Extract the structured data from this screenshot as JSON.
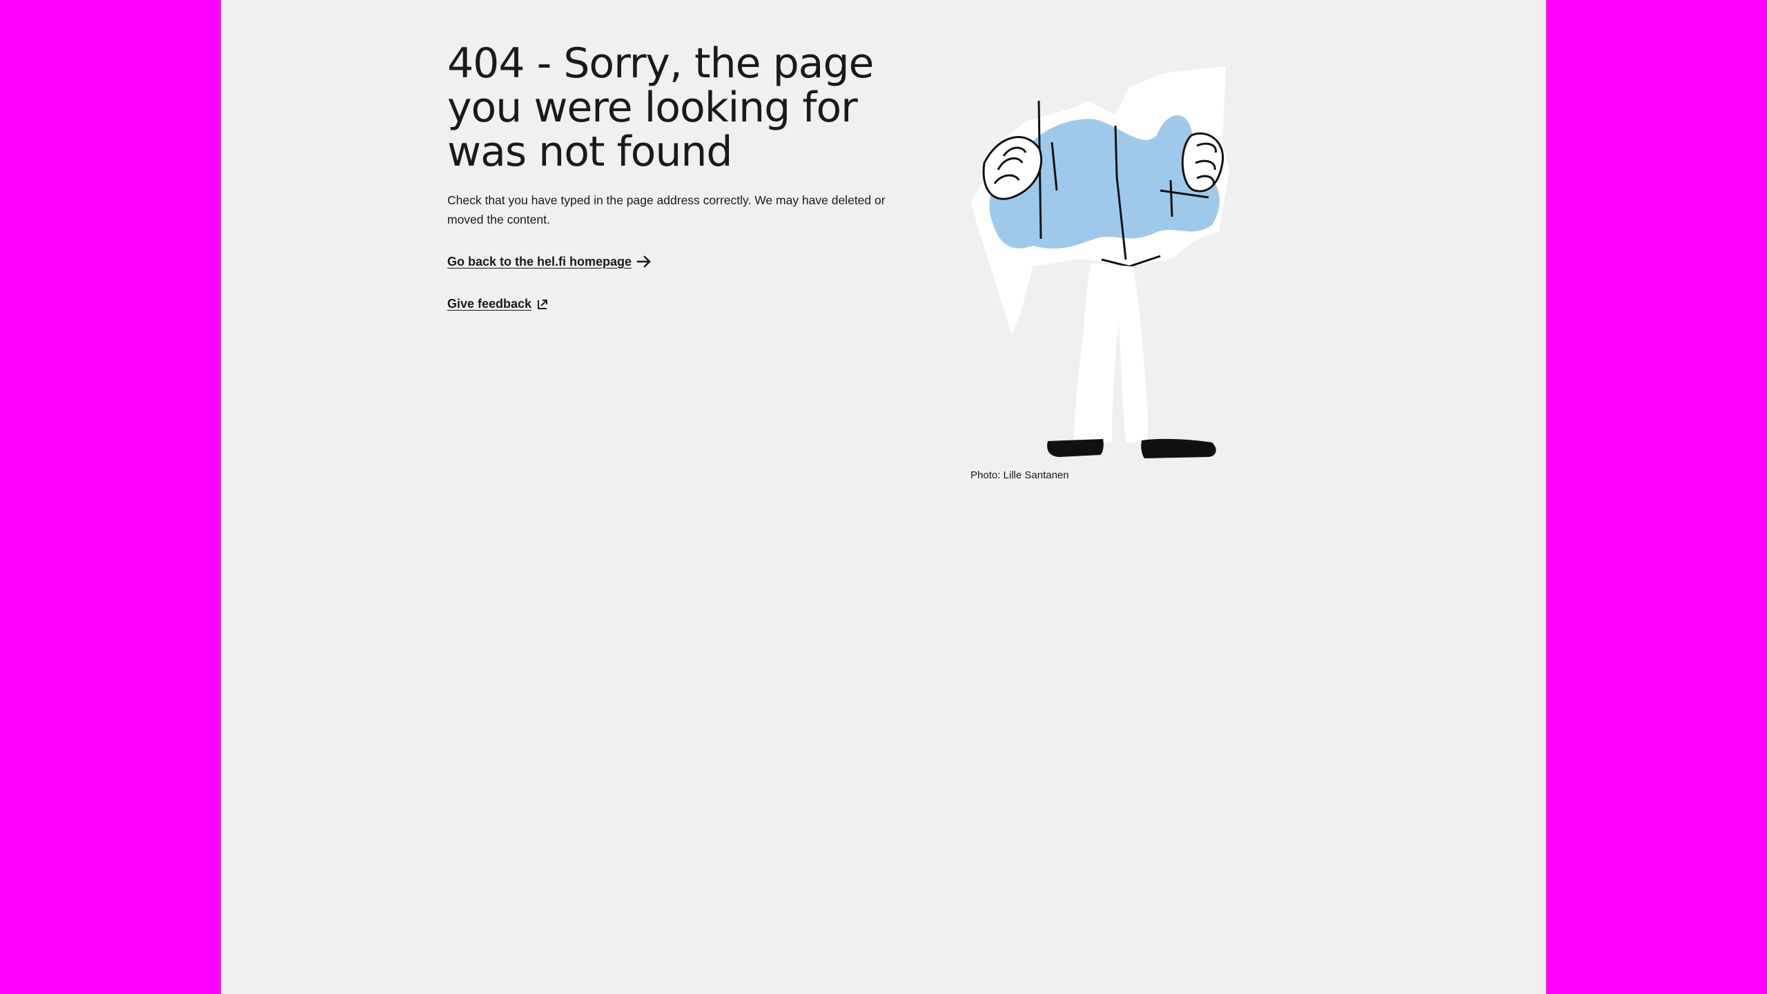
{
  "page": {
    "heading": "404 - Sorry, the page you were looking for was not found",
    "lead": "Check that you have typed in the page address correctly. We may have deleted or moved the content.",
    "home_link_label": "Go back to the hel.fi homepage",
    "feedback_link_label": "Give feedback",
    "photo_credit": "Photo: Lille Santanen"
  },
  "icons": {
    "home_link_icon": "arrow-right-icon",
    "feedback_link_icon": "external-link-icon"
  },
  "colors": {
    "background": "#f0f0f0",
    "outer": "#ff00ff",
    "map_blue": "#9fc9eb",
    "text": "#1a1a1a"
  }
}
